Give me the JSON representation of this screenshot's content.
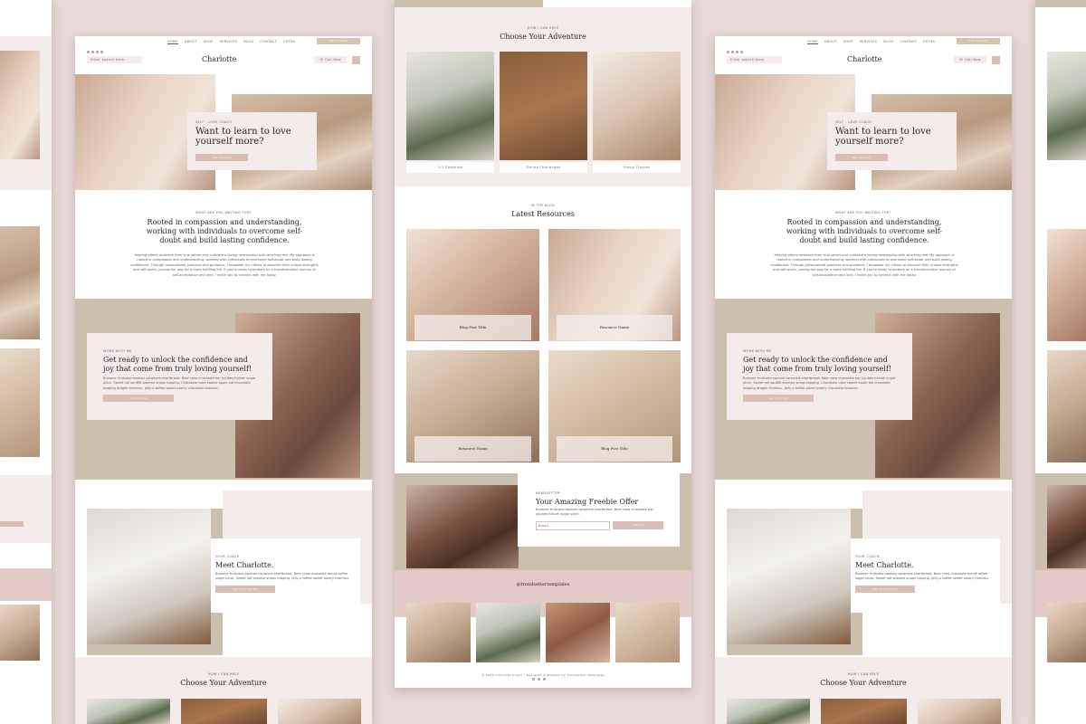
{
  "site": {
    "brand": "Charlotte",
    "search_placeholder": "Enter search term",
    "phone_label": "Call Now",
    "nav": [
      "HOME",
      "ABOUT",
      "SHOP",
      "SERVICES",
      "BLOG",
      "CONTACT",
      "EXTRA"
    ],
    "nav_button": "Get Started",
    "icons": [
      "instagram-icon",
      "facebook-icon",
      "pinterest-icon",
      "twitter-icon",
      "bag-icon",
      "phone-icon"
    ]
  },
  "hero": {
    "eyebrow": "SELF - LOVE COACH",
    "title": "Want to learn to love yourself more?",
    "button": "Get Started"
  },
  "intro": {
    "eyebrow": "WHAT ARE YOU WAITING FOR?",
    "title": "Rooted in compassion and understanding, working with individuals to overcome self-doubt and build lasting confidence.",
    "body": "Helping others embrace their true selves and cultivate a loving relationship with who they are. My approach is rooted in compassion and understanding, working with individuals to overcome self-doubt and build lasting confidence. Through personalized practices and guidance, I empower my clients to discover their unique strengths and self-worth, paving the way for a more fulfilling life. If you're ready to embark on a transformative journey of self-acceptance and love, I invite you to connect with me today."
  },
  "offer": {
    "eyebrow": "WORK WITH ME",
    "title": "Get ready to unlock the confidence and joy that come from truly loving yourself!",
    "body": "Brownie fruitcake bonbon caramels shortbread. Bear claw chocolate bar jujubes halvah sugar plum. Sweet roll soufflé sesame snaps topping. Chocolate cake cookie apple pie chocolate topping dragée tiramisu. Jelly-o toffee sweet pastry chocolate brownie.",
    "button": "Get Started"
  },
  "meet": {
    "eyebrow": "YOUR COACH",
    "title": "Meet Charlotte.",
    "body": "Brownie fruitcake bonbon caramels shortbread. Bear claw chocolate donut toffee sugar plum. Sweet roll sesame snaps topping. Jelly-o toffee sweet pastry tiramisu cupcake.",
    "button": "Get To Know Me"
  },
  "adventure": {
    "eyebrow": "HOW I CAN HELP",
    "title": "Choose Your Adventure",
    "items": [
      "1:1 Coaching",
      "Online Challenges",
      "Group Classes"
    ]
  },
  "resources": {
    "eyebrow": "IN THE BLOG",
    "title": "Latest Resources",
    "cards": [
      "Blog Post Title",
      "Resource Name",
      "Resource Name",
      "Blog Post Title"
    ]
  },
  "newsletter": {
    "eyebrow": "NEWSLETTER",
    "title": "Your Amazing Freebie Offer",
    "body": "Brownie fruitcake bonbon caramels shortbread. Bear claw chocolate bar jujubes halvah sugar plum.",
    "email_placeholder": "Email",
    "button": "Submit"
  },
  "instagram": {
    "handle": "@trendsettertemplates"
  },
  "footer": {
    "copyright": "© 2025 Charlotte Coach | Designed & Website by Trendsetter Templates"
  },
  "colors": {
    "background": "#e5d8d6",
    "blush": "#d9bdb6",
    "card": "#f4ecea",
    "taupe": "#cbbfae",
    "rose_band": "#e2cbc7",
    "text": "#2b2421"
  }
}
